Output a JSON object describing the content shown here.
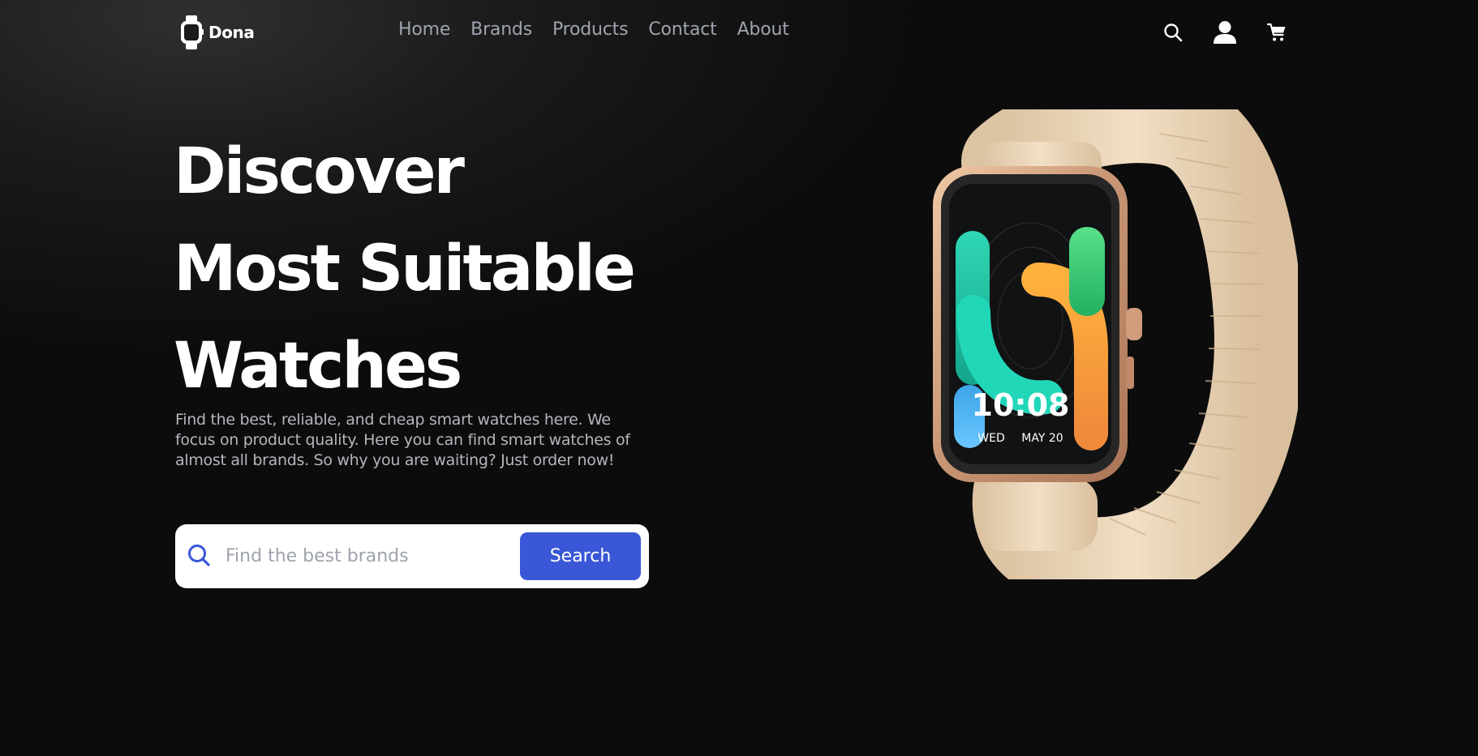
{
  "brand": {
    "name": "Dona",
    "logo_icon": "smartwatch-icon"
  },
  "nav": {
    "links": [
      {
        "label": "Home"
      },
      {
        "label": "Brands"
      },
      {
        "label": "Products"
      },
      {
        "label": "Contact"
      },
      {
        "label": "About"
      }
    ],
    "icons": [
      "search-icon",
      "user-icon",
      "cart-icon"
    ]
  },
  "hero": {
    "title_lines": [
      "Discover",
      "Most Suitable",
      "Watches"
    ],
    "description": "Find the best, reliable, and cheap smart watches here. We focus on product quality. Here you can find smart watches of almost all brands. So why you are waiting? Just order now!",
    "search": {
      "placeholder": "Find the best brands",
      "value": "",
      "button_label": "Search"
    },
    "watch_face": {
      "time": "10:08",
      "day": "WED",
      "date": "MAY 20"
    }
  },
  "colors": {
    "background": "#0c0c0c",
    "accent": "#3957d6",
    "nav_text": "#9ea3ad",
    "body_text": "#b3b6bd",
    "heading": "#ffffff"
  }
}
